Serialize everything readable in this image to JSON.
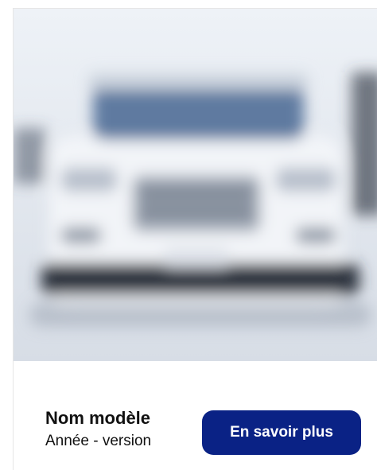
{
  "card": {
    "image_alt": "car-photo-blurred",
    "title": "Nom modèle",
    "subtitle": "Année - version",
    "cta_label": "En savoir plus"
  },
  "colors": {
    "cta_background": "#0a2285",
    "cta_text": "#ffffff",
    "text": "#111111"
  }
}
